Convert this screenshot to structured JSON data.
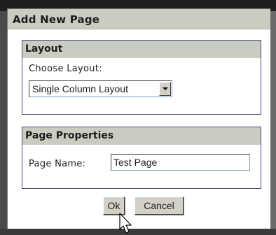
{
  "dialog": {
    "title": "Add New Page"
  },
  "layout_section": {
    "header": "Layout",
    "choose_label": "Choose Layout:",
    "selected_layout": "Single Column Layout"
  },
  "properties_section": {
    "header": "Page Properties",
    "page_name_label": "Page Name:",
    "page_name_value": "Test Page"
  },
  "buttons": {
    "ok_label": "Ok",
    "cancel_label": "Cancel"
  },
  "colors": {
    "header_bg": "#c9ccc0",
    "section_border": "#4a4a7a",
    "button_face": "#d4d0c8"
  },
  "icons": {
    "dropdown": "chevron-down-icon",
    "cursor": "mouse-pointer-icon"
  }
}
